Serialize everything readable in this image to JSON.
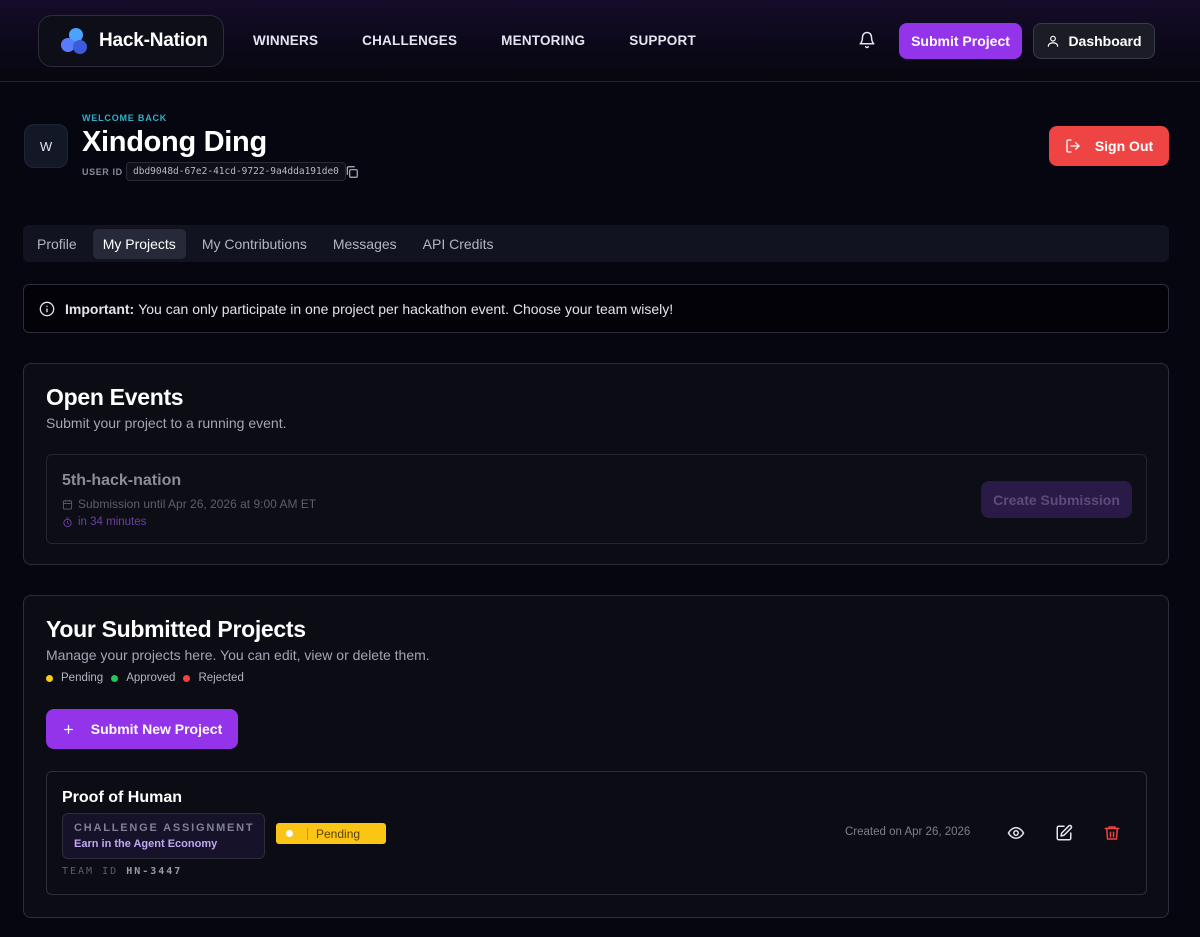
{
  "header": {
    "brand": "Hack-Nation",
    "nav": [
      "WINNERS",
      "CHALLENGES",
      "MENTORING",
      "SUPPORT"
    ],
    "submit_label": "Submit Project",
    "dashboard_label": "Dashboard"
  },
  "user": {
    "welcome": "WELCOME BACK",
    "avatar_letter": "W",
    "name": "Xindong Ding",
    "id_label": "USER ID",
    "id_value": "dbd9048d-67e2-41cd-9722-9a4dda191de0",
    "sign_out_label": "Sign Out"
  },
  "tabs": [
    "Profile",
    "My Projects",
    "My Contributions",
    "Messages",
    "API Credits"
  ],
  "active_tab": "My Projects",
  "alert": {
    "bold": "Important:",
    "text": "You can only participate in one project per hackathon event. Choose your team wisely!"
  },
  "open_events": {
    "title": "Open Events",
    "subtitle": "Submit your project to a running event.",
    "event": {
      "name": "5th-hack-nation",
      "until": "Submission until Apr 26, 2026 at 9:00 AM ET",
      "countdown": "in 34 minutes",
      "button": "Create Submission"
    }
  },
  "submitted": {
    "title": "Your Submitted Projects",
    "subtitle": "Manage your projects here. You can edit, view or delete them.",
    "legend": [
      {
        "label": "Pending",
        "color": "#facc15"
      },
      {
        "label": "Approved",
        "color": "#22c55e"
      },
      {
        "label": "Rejected",
        "color": "#ef4444"
      }
    ],
    "new_button": "Submit New Project",
    "project": {
      "name": "Proof of Human",
      "assignment_label": "CHALLENGE ASSIGNMENT",
      "assignment_value": "Earn in the Agent Economy",
      "status": "Pending",
      "team_id_label": "TEAM ID",
      "team_id": "HN-3447",
      "created": "Created on Apr 26, 2026"
    }
  },
  "colors": {
    "accent": "#9333ea",
    "danger": "#ef4444",
    "pending": "#facc15"
  }
}
